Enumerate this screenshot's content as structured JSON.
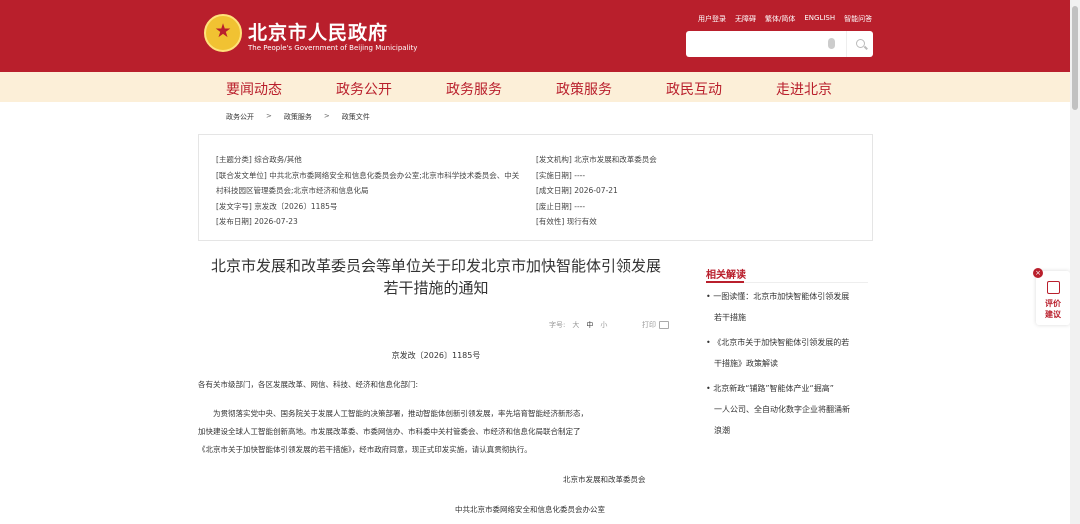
{
  "header": {
    "title": "北京市人民政府",
    "subtitle": "The People's Government of Beijing Municipality",
    "top_links": [
      "用户登录",
      "无障碍",
      "繁体/简体",
      "ENGLISH",
      "智能问答"
    ],
    "search": {
      "placeholder": ""
    }
  },
  "nav": {
    "items": [
      "要闻动态",
      "政务公开",
      "政务服务",
      "政策服务",
      "政民互动",
      "走进北京"
    ]
  },
  "breadcrumb": [
    "政务公开",
    "政策服务",
    "政策文件"
  ],
  "meta": {
    "category": "[主题分类] 综合政务/其他",
    "joint_units_1": "[联合发文单位] 中共北京市委网络安全和信息化委员会办公室;北京市科学技术委员会、中关",
    "joint_units_2": "村科技园区管理委员会;北京市经济和信息化局",
    "doc_no": "[发文字号] 京发改〔2026〕1185号",
    "publish_date": "[发布日期] 2026-07-23",
    "issuer": "[发文机构] 北京市发展和改革委员会",
    "effective_date": "[实施日期] ----",
    "written_date": "[成文日期] 2026-07-21",
    "abolish_date": "[废止日期] ----",
    "validity": "[有效性] 现行有效"
  },
  "article": {
    "title_line1": "北京市发展和改革委员会等单位关于印发北京市加快智能体引领发展",
    "title_line2": "若干措施的通知",
    "fontsize_label": "字号:",
    "fontsize_large": "大",
    "fontsize_medium": "中",
    "fontsize_small": "小",
    "print_label": "打印",
    "doc_number": "京发改〔2026〕1185号",
    "salutation": "各有关市级部门，各区发展改革、网信、科技、经济和信息化部门:",
    "para1_line1": "为贯彻落实党中央、国务院关于发展人工智能的决策部署，推动智能体创新引领发展，率先培育智能经济新形态，",
    "para1_line2": "加快建设全球人工智能创新高地。市发展改革委、市委网信办、市科委中关村管委会、市经济和信息化局联合制定了",
    "para1_line3": "《北京市关于加快智能体引领发展的若干措施》，经市政府同意，现正式印发实施，请认真贯彻执行。",
    "signer1": "北京市发展和改革委员会",
    "signer2": "中共北京市委网络安全和信息化委员会办公室"
  },
  "sidebar": {
    "title": "相关解读",
    "items": [
      {
        "line1": "• 一图读懂：北京市加快智能体引领发展",
        "line2": "若干措施"
      },
      {
        "line1": "• 《北京市关于加快智能体引领发展的若",
        "line2": "干措施》政策解读"
      },
      {
        "line1": "• 北京新政“铺路”智能体产业“掘高”",
        "line2": "一人公司、全自动化数字企业将翻涌新",
        "line3": "浪潮"
      }
    ]
  },
  "evaluate": {
    "close": "×",
    "line1": "评价",
    "line2": "建议"
  }
}
